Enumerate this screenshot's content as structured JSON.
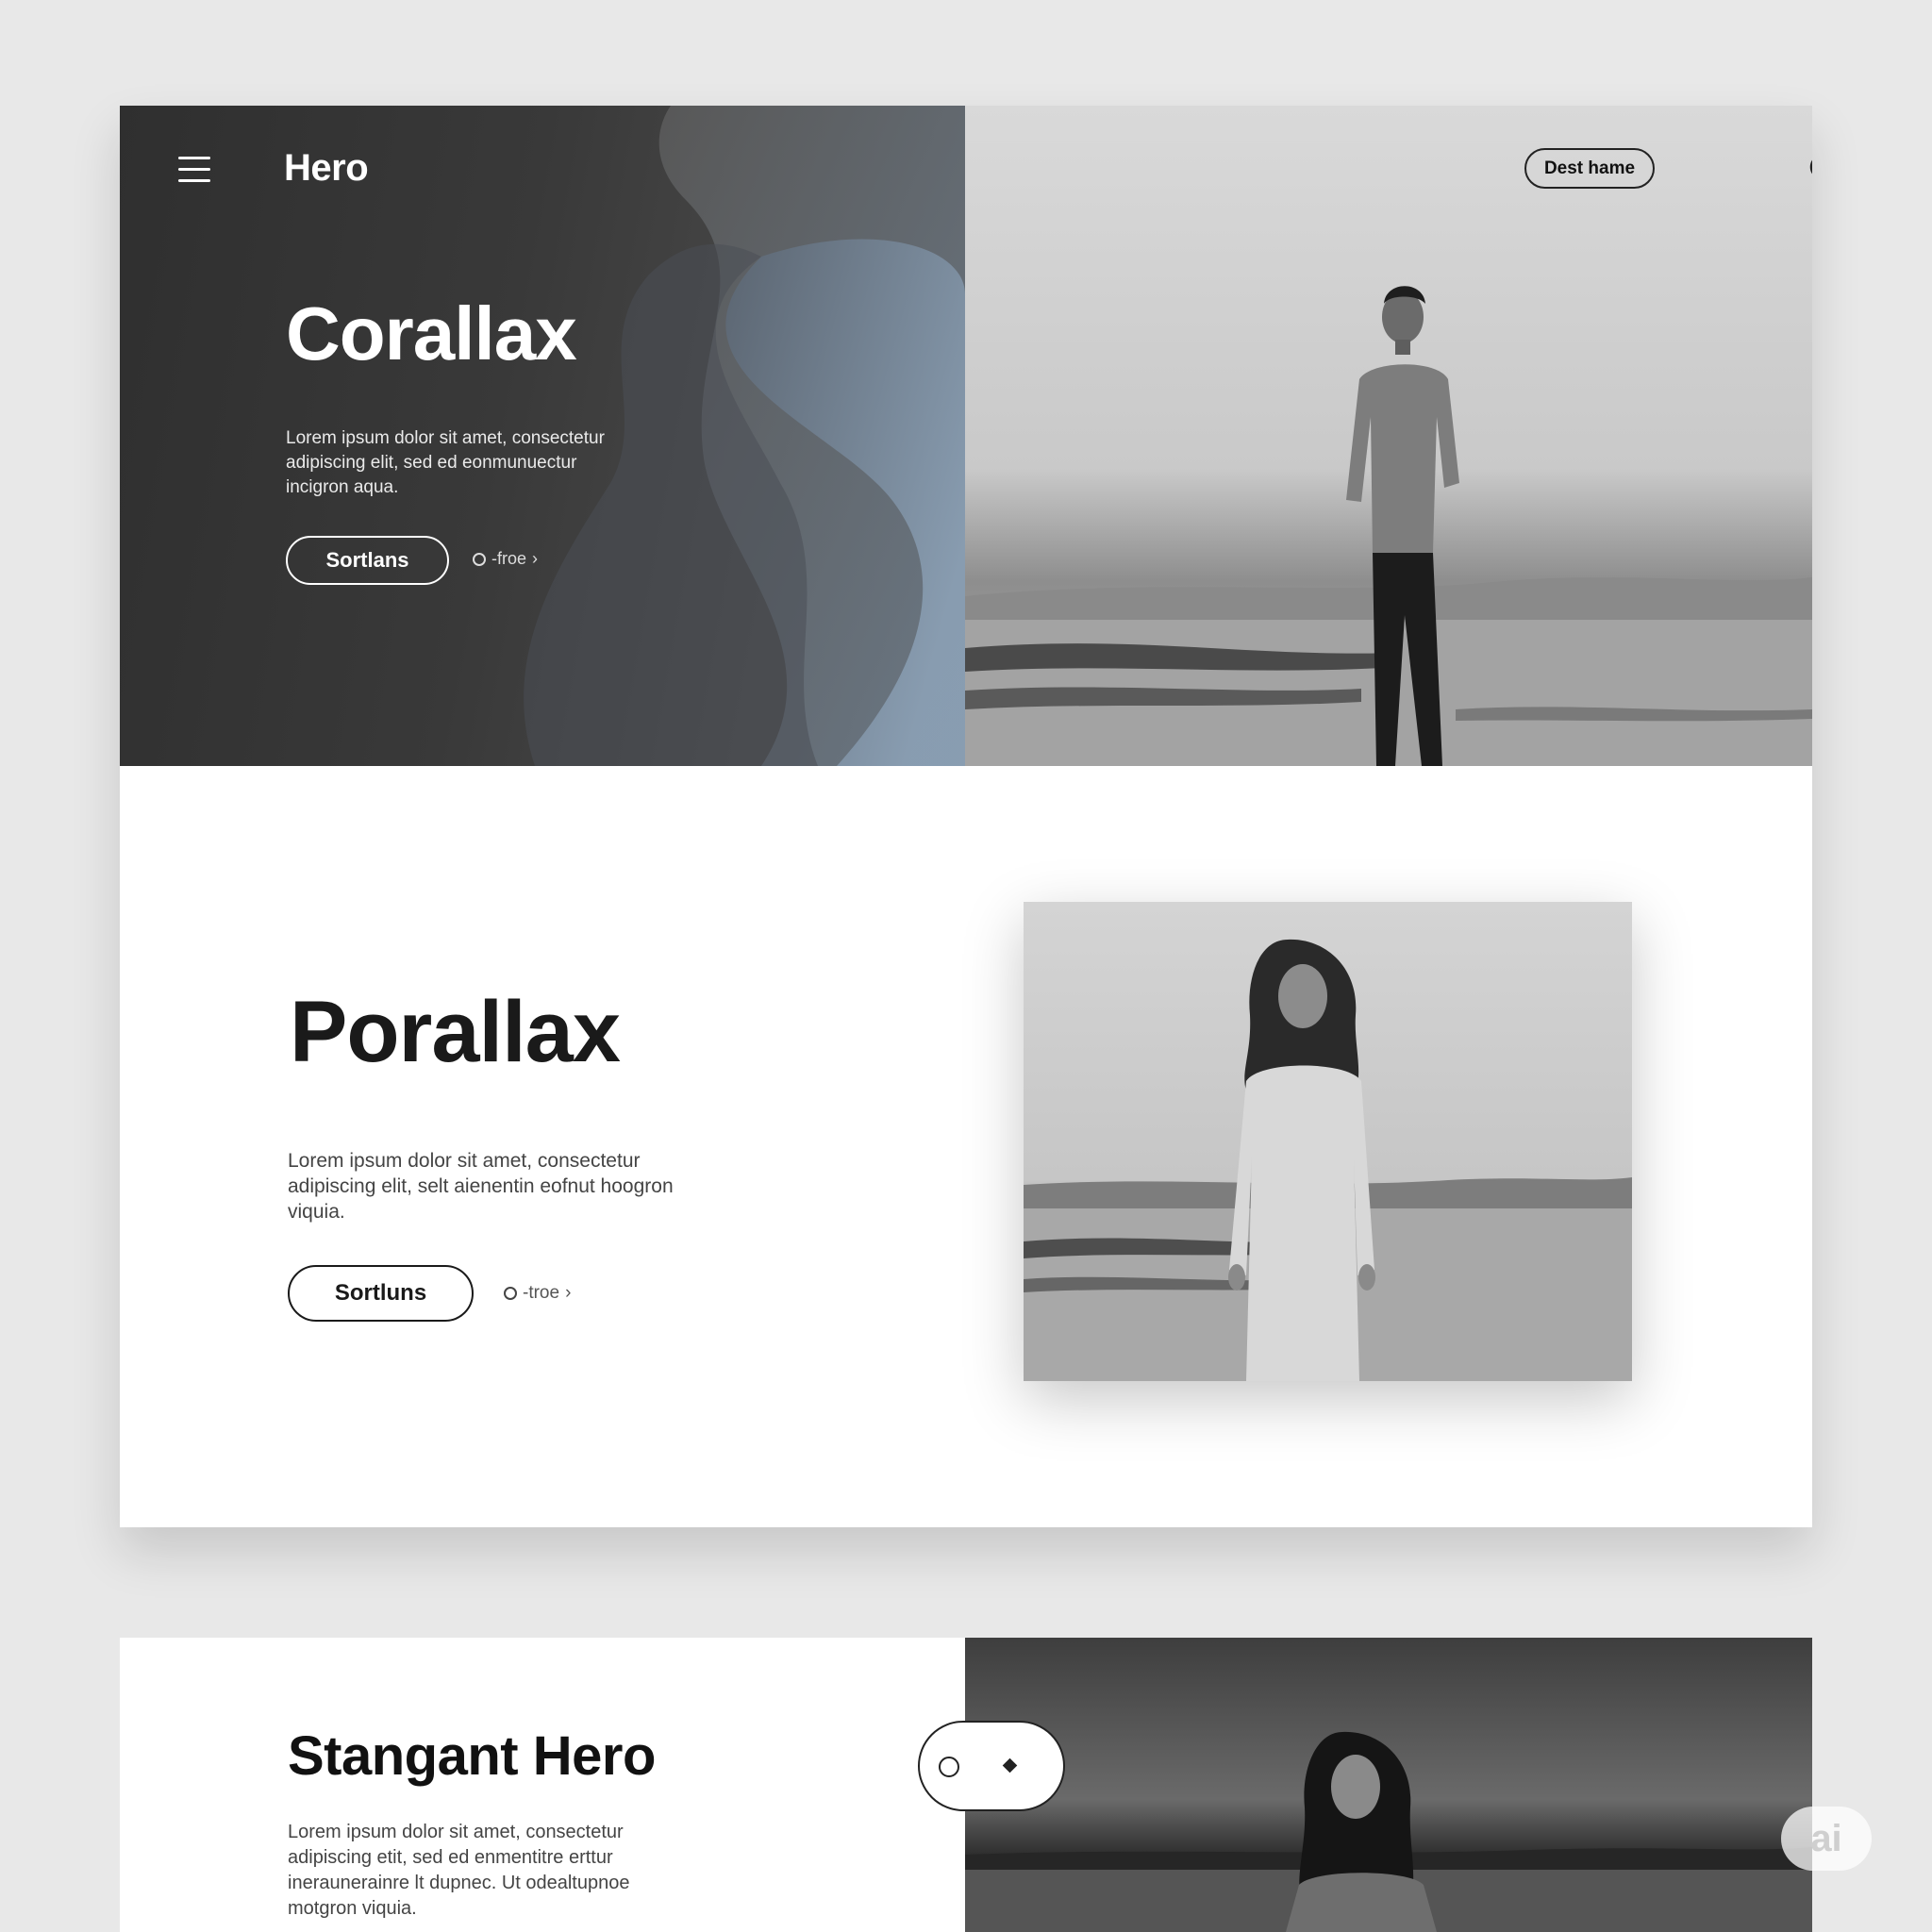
{
  "header": {
    "brand": "Hero",
    "nav_button_label": "Dest hame"
  },
  "hero": {
    "title": "Corallax",
    "text": "Lorem ipsum dolor sit amet, consectetur adipiscing elit, sed ed eonmunuectur incigron aqua.",
    "primary_button_label": "Sortlans",
    "secondary_link_label": "-froe"
  },
  "section2": {
    "title": "Porallax",
    "text": "Lorem ipsum dolor sit amet, consectetur adipiscing elit, selt aienentin eofnut hoogron viquia.",
    "primary_button_label": "Sortluns",
    "secondary_link_label": "-troe"
  },
  "section3": {
    "title": "Stangant Hero",
    "text": "Lorem ipsum dolor sit amet, consectetur adipiscing etit, sed ed enmentitre erttur ineraunerainre lt dupnec. Ut odealtupnoe motgron viquia."
  },
  "badge_label": "ai",
  "colors": {
    "dark_panel": "#333333",
    "accent_blue_gray": "#8da0b4",
    "text_dark": "#1a1a1a",
    "background": "#e8e8e8"
  },
  "icons": [
    "menu-icon",
    "search-icon",
    "chevron-right-icon",
    "circle-icon",
    "diamond-icon"
  ]
}
